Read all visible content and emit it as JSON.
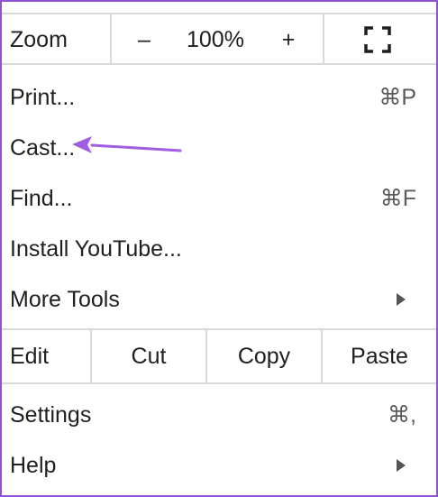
{
  "zoom": {
    "label": "Zoom",
    "minus": "–",
    "level": "100%",
    "plus": "+",
    "fullscreen_icon": "fullscreen-icon"
  },
  "menu": {
    "print": {
      "label": "Print...",
      "shortcut": "⌘P"
    },
    "cast": {
      "label": "Cast..."
    },
    "find": {
      "label": "Find...",
      "shortcut": "⌘F"
    },
    "install": {
      "label": "Install YouTube..."
    },
    "more_tools": {
      "label": "More Tools"
    }
  },
  "edit": {
    "label": "Edit",
    "cut": "Cut",
    "copy": "Copy",
    "paste": "Paste"
  },
  "bottom": {
    "settings": {
      "label": "Settings",
      "shortcut": "⌘,"
    },
    "help": {
      "label": "Help"
    }
  },
  "annotation": {
    "arrow_color": "#a25ee0"
  },
  "colors": {
    "border": "#8e52d4",
    "divider": "#d9d9d9",
    "text": "#1f1f1f"
  }
}
